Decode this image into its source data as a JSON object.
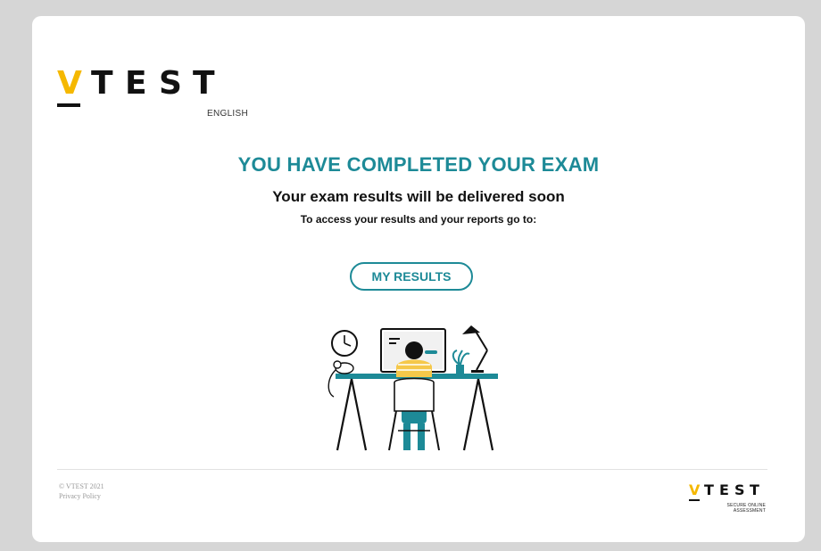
{
  "logo": {
    "letters": [
      "V",
      "T",
      "E",
      "S",
      "T"
    ],
    "subtitle": "ENGLISH"
  },
  "main": {
    "headline": "YOU HAVE COMPLETED YOUR EXAM",
    "subheadline": "Your exam results will be delivered soon",
    "instruction": "To access your results and your reports go to:",
    "results_button_label": "MY RESULTS",
    "illustration_icon": "person-at-desk-illustration"
  },
  "footer": {
    "copyright": "© VTEST 2021",
    "privacy_link": "Privacy Policy",
    "mini_logo": {
      "letters": [
        "V",
        "T",
        "E",
        "S",
        "T"
      ],
      "tagline_line1": "SECURE ONLINE",
      "tagline_line2": "ASSESSMENT"
    }
  },
  "colors": {
    "accent": "#1d8a97",
    "brand_yellow": "#f5b800",
    "background": "#d6d6d6"
  }
}
